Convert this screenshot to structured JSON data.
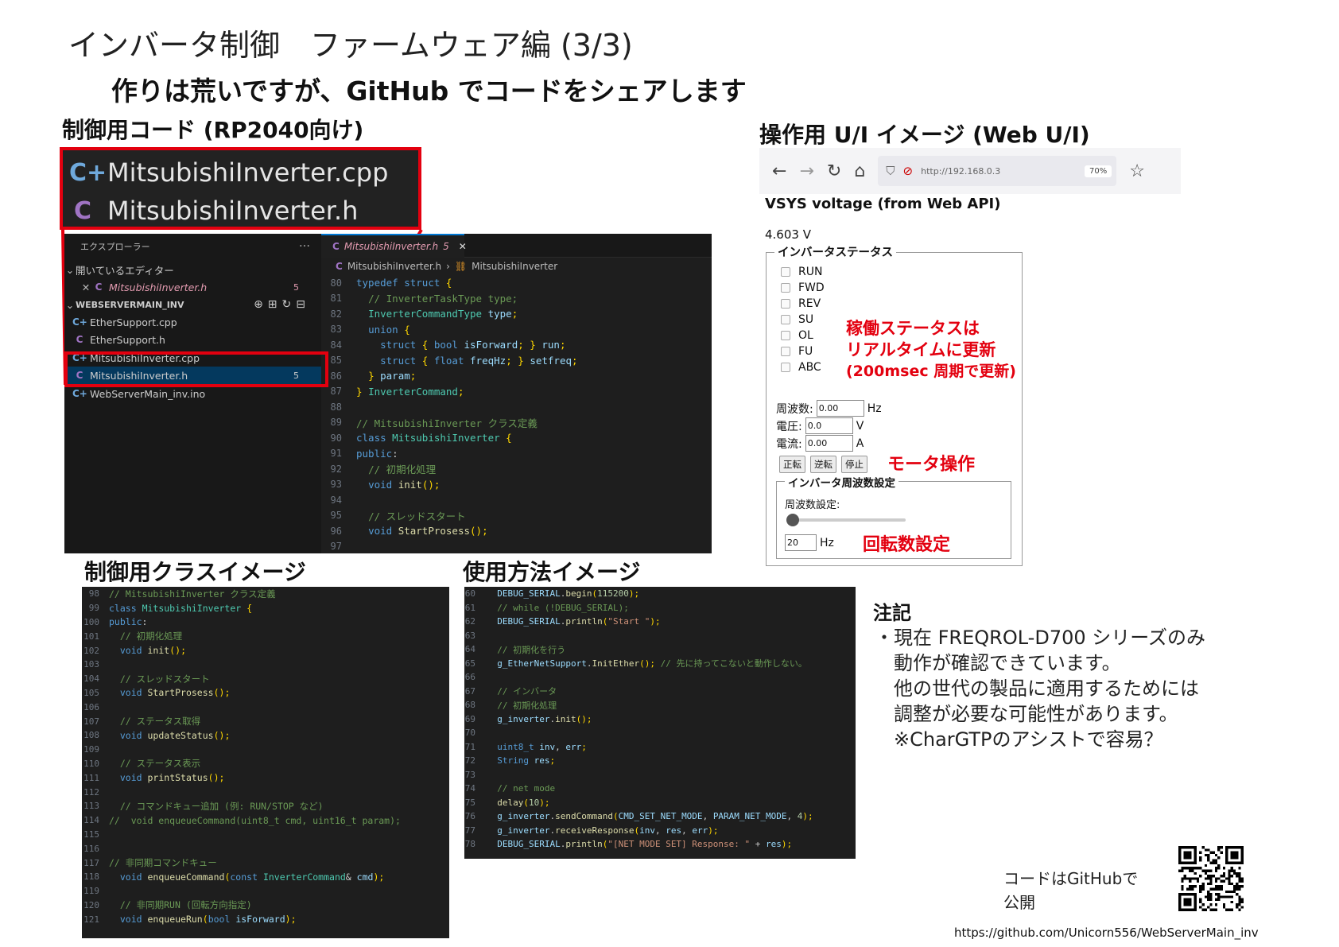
{
  "slide": {
    "title": "インバータ制御　ファームウェア編 (3/3)",
    "subtitle": "作りは荒いですが、GitHub でコードをシェアします",
    "sec_code": "制御用コード (RP2040向け)",
    "sec_ui": "操作用 U/I イメージ (Web U/I)",
    "sec_class": "制御用クラスイメージ",
    "sec_usage": "使用方法イメージ"
  },
  "files": [
    {
      "icon": "C+",
      "name": "MitsubishiInverter.cpp"
    },
    {
      "icon": "C",
      "name": "MitsubishiInverter.h"
    }
  ],
  "explorer": {
    "header": "エクスプローラー",
    "more": "…",
    "open_editors": "開いているエディター",
    "open_file": "MitsubishiInverter.h",
    "open_file_badge": "5",
    "workspace": "WEBSERVERMAIN_INV",
    "items": [
      {
        "icon": "C+",
        "name": "EtherSupport.cpp"
      },
      {
        "icon": "C",
        "name": "EtherSupport.h"
      },
      {
        "icon": "C+",
        "name": "MitsubishiInverter.cpp"
      },
      {
        "icon": "C",
        "name": "MitsubishiInverter.h",
        "badge": "5"
      },
      {
        "icon": "C+",
        "name": "WebServerMain_inv.ino"
      }
    ]
  },
  "editor": {
    "tab": "MitsubishiInverter.h",
    "tab_badge": "5",
    "crumb_file": "MitsubishiInverter.h",
    "crumb_class": "MitsubishiInverter",
    "lines": [
      {
        "n": "80",
        "t": "typedef struct {"
      },
      {
        "n": "81",
        "t": "  // InverterTaskType type;"
      },
      {
        "n": "82",
        "t": "  InverterCommandType type;"
      },
      {
        "n": "83",
        "t": "  union {"
      },
      {
        "n": "84",
        "t": "    struct { bool isForward; } run;"
      },
      {
        "n": "85",
        "t": "    struct { float freqHz; } setfreq;"
      },
      {
        "n": "86",
        "t": "  } param;"
      },
      {
        "n": "87",
        "t": "} InverterCommand;"
      },
      {
        "n": "88",
        "t": ""
      },
      {
        "n": "89",
        "t": "// MitsubishiInverter クラス定義"
      },
      {
        "n": "90",
        "t": "class MitsubishiInverter {"
      },
      {
        "n": "91",
        "t": "public:"
      },
      {
        "n": "92",
        "t": "  // 初期化処理"
      },
      {
        "n": "93",
        "t": "  void init();"
      },
      {
        "n": "94",
        "t": ""
      },
      {
        "n": "95",
        "t": "  // スレッドスタート"
      },
      {
        "n": "96",
        "t": "  void StartProsess();"
      },
      {
        "n": "97",
        "t": ""
      }
    ]
  },
  "class_code": [
    {
      "n": "98",
      "t": "// MitsubishiInverter クラス定義"
    },
    {
      "n": "99",
      "t": "class MitsubishiInverter {"
    },
    {
      "n": "100",
      "t": "public:"
    },
    {
      "n": "101",
      "t": "  // 初期化処理"
    },
    {
      "n": "102",
      "t": "  void init();"
    },
    {
      "n": "103",
      "t": ""
    },
    {
      "n": "104",
      "t": "  // スレッドスタート"
    },
    {
      "n": "105",
      "t": "  void StartProsess();"
    },
    {
      "n": "106",
      "t": ""
    },
    {
      "n": "107",
      "t": "  // ステータス取得"
    },
    {
      "n": "108",
      "t": "  void updateStatus();"
    },
    {
      "n": "109",
      "t": ""
    },
    {
      "n": "110",
      "t": "  // ステータス表示"
    },
    {
      "n": "111",
      "t": "  void printStatus();"
    },
    {
      "n": "112",
      "t": ""
    },
    {
      "n": "113",
      "t": "  // コマンドキュー追加 (例: RUN/STOP など)"
    },
    {
      "n": "114",
      "t": "//  void enqueueCommand(uint8_t cmd, uint16_t param);"
    },
    {
      "n": "115",
      "t": ""
    },
    {
      "n": "116",
      "t": ""
    },
    {
      "n": "117",
      "t": "// 非同期コマンドキュー"
    },
    {
      "n": "118",
      "t": "  void enqueueCommand(const InverterCommand& cmd);"
    },
    {
      "n": "119",
      "t": ""
    },
    {
      "n": "120",
      "t": "  // 非同期RUN (回転方向指定)"
    },
    {
      "n": "121",
      "t": "  void enqueueRun(bool isForward);"
    }
  ],
  "usage_code": [
    {
      "n": "60",
      "t": "  DEBUG_SERIAL.begin(115200);"
    },
    {
      "n": "61",
      "t": "  // while (!DEBUG_SERIAL);"
    },
    {
      "n": "62",
      "t": "  DEBUG_SERIAL.println(\"Start \");"
    },
    {
      "n": "63",
      "t": ""
    },
    {
      "n": "64",
      "t": "  // 初期化を行う"
    },
    {
      "n": "65",
      "t": "  g_EtherNetSupport.InitEther(); // 先に持ってこないと動作しない。"
    },
    {
      "n": "66",
      "t": ""
    },
    {
      "n": "67",
      "t": "  // インバータ"
    },
    {
      "n": "68",
      "t": "  // 初期化処理"
    },
    {
      "n": "69",
      "t": "  g_inverter.init();"
    },
    {
      "n": "70",
      "t": ""
    },
    {
      "n": "71",
      "t": "  uint8_t inv, err;"
    },
    {
      "n": "72",
      "t": "  String res;"
    },
    {
      "n": "73",
      "t": ""
    },
    {
      "n": "74",
      "t": "  // net mode"
    },
    {
      "n": "75",
      "t": "  delay(10);"
    },
    {
      "n": "76",
      "t": "  g_inverter.sendCommand(CMD_SET_NET_MODE, PARAM_NET_MODE, 4);"
    },
    {
      "n": "77",
      "t": "  g_inverter.receiveResponse(inv, res, err);"
    },
    {
      "n": "78",
      "t": "  DEBUG_SERIAL.println(\"[NET MODE SET] Response: \" + res);"
    }
  ],
  "browser": {
    "url": "http://192.168.0.3",
    "zoom": "70%"
  },
  "web": {
    "title": "VSYS voltage (from Web API)",
    "voltage": "4.603 V",
    "status_legend": "インバータステータス",
    "status_items": [
      "RUN",
      "FWD",
      "REV",
      "SU",
      "OL",
      "FU",
      "ABC"
    ],
    "freq_label": "周波数:",
    "freq_value": "0.00",
    "freq_unit": "Hz",
    "volt_label": "電圧:",
    "volt_value": "0.0",
    "volt_unit": "V",
    "curr_label": "電流:",
    "curr_value": "0.00",
    "curr_unit": "A",
    "btn_fwd": "正転",
    "btn_rev": "逆転",
    "btn_stop": "停止",
    "freq_legend": "インバータ周波数設定",
    "freq_setting_label": "周波数設定:",
    "freq_set_value": "20",
    "freq_set_unit": "Hz",
    "slider_level": 0.0
  },
  "annotations": {
    "status_line1": "稼働ステータスは",
    "status_line2": "リアルタイムに更新",
    "status_line3": "(200msec 周期で更新)",
    "motor": "モータ操作",
    "rpm": "回転数設定"
  },
  "notes": {
    "title": "注記",
    "lines": [
      "・現在 FREQROL-D700 シリーズのみ",
      "　動作が確認できています。",
      "　他の世代の製品に適用するためには",
      "　調整が必要な可能性があります。",
      "　※CharGTPのアシストで容易？"
    ]
  },
  "github": {
    "line1": "コードはGitHubで",
    "line2": "公開",
    "url": "https://github.com/Unicorn556/WebServerMain_inv"
  },
  "colors": {
    "accent_red": "#e3000f",
    "editor_bg": "#1e1e1e",
    "selection": "#04395e"
  }
}
